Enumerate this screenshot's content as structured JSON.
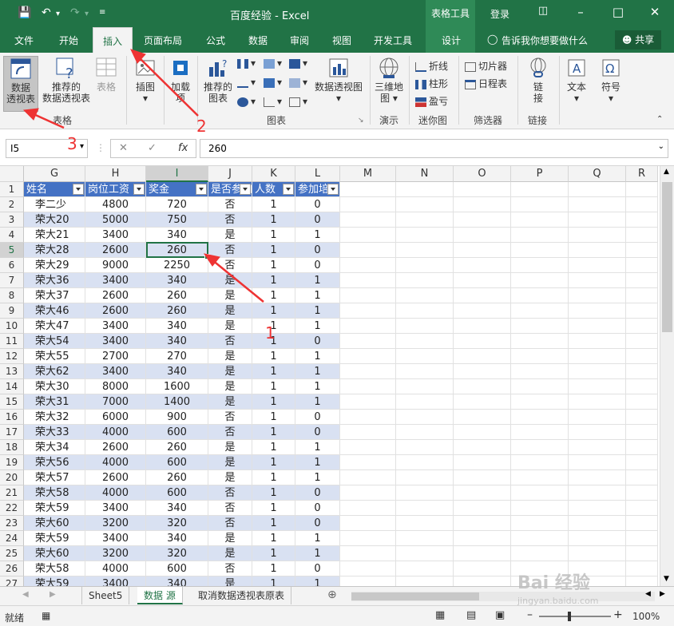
{
  "titlebar": {
    "doc_title": "百度经验  -  Excel",
    "context_tab": "表格工具",
    "login": "登录",
    "save_icon": "save-icon",
    "undo_icon": "undo-icon",
    "redo_icon": "redo-icon",
    "customize_icon": "chevron-down-icon"
  },
  "tabs": {
    "items": [
      "文件",
      "开始",
      "插入",
      "页面布局",
      "公式",
      "数据",
      "审阅",
      "视图",
      "开发工具",
      "设计"
    ],
    "active": "插入",
    "tell_me": "告诉我你想要做什么",
    "share": "共享"
  },
  "ribbon": {
    "pivot_table": "数据\n透视表",
    "pivot_table_l1": "数据",
    "pivot_table_l2": "透视表",
    "recommended_pivot_l1": "推荐的",
    "recommended_pivot_l2": "数据透视表",
    "table": "表格",
    "group_tables": "表格",
    "illustrations": "插图",
    "addins_l1": "加载",
    "addins_l2": "项",
    "recommended_charts_l1": "推荐的",
    "recommended_charts_l2": "图表",
    "pivot_chart": "数据透视图",
    "group_charts": "图表",
    "map3d_l1": "三维地",
    "map3d_l2": "图",
    "group_tours": "演示",
    "spark_line": "折线",
    "spark_column": "柱形",
    "spark_winloss": "盈亏",
    "group_sparklines": "迷你图",
    "slicer": "切片器",
    "timeline": "日程表",
    "group_filters": "筛选器",
    "link_l1": "链",
    "link_l2": "接",
    "group_links": "链接",
    "text": "文本",
    "symbol": "符号"
  },
  "formula_bar": {
    "name_box": "I5",
    "fx": "fx",
    "value": "260"
  },
  "grid": {
    "columns": [
      "G",
      "H",
      "I",
      "J",
      "K",
      "L",
      "M",
      "N",
      "O",
      "P",
      "Q",
      "R"
    ],
    "selected_col": "I",
    "selected_row": "5",
    "header_row": [
      "姓名",
      "岗位工资",
      "奖金",
      "是否参加",
      "人数",
      "参加培训"
    ],
    "rows": [
      {
        "n": "2",
        "c": [
          "李二少",
          "4800",
          "720",
          "否",
          "1",
          "0"
        ]
      },
      {
        "n": "3",
        "c": [
          "荣大20",
          "5000",
          "750",
          "否",
          "1",
          "0"
        ]
      },
      {
        "n": "4",
        "c": [
          "荣大21",
          "3400",
          "340",
          "是",
          "1",
          "1"
        ]
      },
      {
        "n": "5",
        "c": [
          "荣大28",
          "2600",
          "260",
          "否",
          "1",
          "0"
        ]
      },
      {
        "n": "6",
        "c": [
          "荣大29",
          "9000",
          "2250",
          "否",
          "1",
          "0"
        ]
      },
      {
        "n": "7",
        "c": [
          "荣大36",
          "3400",
          "340",
          "是",
          "1",
          "1"
        ]
      },
      {
        "n": "8",
        "c": [
          "荣大37",
          "2600",
          "260",
          "是",
          "1",
          "1"
        ]
      },
      {
        "n": "9",
        "c": [
          "荣大46",
          "2600",
          "260",
          "是",
          "1",
          "1"
        ]
      },
      {
        "n": "10",
        "c": [
          "荣大47",
          "3400",
          "340",
          "是",
          "1",
          "1"
        ]
      },
      {
        "n": "11",
        "c": [
          "荣大54",
          "3400",
          "340",
          "否",
          "1",
          "0"
        ]
      },
      {
        "n": "12",
        "c": [
          "荣大55",
          "2700",
          "270",
          "是",
          "1",
          "1"
        ]
      },
      {
        "n": "13",
        "c": [
          "荣大62",
          "3400",
          "340",
          "是",
          "1",
          "1"
        ]
      },
      {
        "n": "14",
        "c": [
          "荣大30",
          "8000",
          "1600",
          "是",
          "1",
          "1"
        ]
      },
      {
        "n": "15",
        "c": [
          "荣大31",
          "7000",
          "1400",
          "是",
          "1",
          "1"
        ]
      },
      {
        "n": "16",
        "c": [
          "荣大32",
          "6000",
          "900",
          "否",
          "1",
          "0"
        ]
      },
      {
        "n": "17",
        "c": [
          "荣大33",
          "4000",
          "600",
          "否",
          "1",
          "0"
        ]
      },
      {
        "n": "18",
        "c": [
          "荣大34",
          "2600",
          "260",
          "是",
          "1",
          "1"
        ]
      },
      {
        "n": "19",
        "c": [
          "荣大56",
          "4000",
          "600",
          "是",
          "1",
          "1"
        ]
      },
      {
        "n": "20",
        "c": [
          "荣大57",
          "2600",
          "260",
          "是",
          "1",
          "1"
        ]
      },
      {
        "n": "21",
        "c": [
          "荣大58",
          "4000",
          "600",
          "否",
          "1",
          "0"
        ]
      },
      {
        "n": "22",
        "c": [
          "荣大59",
          "3400",
          "340",
          "否",
          "1",
          "0"
        ]
      },
      {
        "n": "23",
        "c": [
          "荣大60",
          "3200",
          "320",
          "否",
          "1",
          "0"
        ]
      },
      {
        "n": "24",
        "c": [
          "荣大59",
          "3400",
          "340",
          "是",
          "1",
          "1"
        ]
      },
      {
        "n": "25",
        "c": [
          "荣大60",
          "3200",
          "320",
          "是",
          "1",
          "1"
        ]
      },
      {
        "n": "26",
        "c": [
          "荣大58",
          "4000",
          "600",
          "否",
          "1",
          "0"
        ]
      },
      {
        "n": "27",
        "c": [
          "荣大59",
          "3400",
          "340",
          "是",
          "1",
          "1"
        ]
      }
    ]
  },
  "sheet_tabs": {
    "items": [
      "Sheet5",
      "数据 源",
      "取消数据透视表原表"
    ],
    "active": "数据 源",
    "add_icon": "plus-icon"
  },
  "status": {
    "ready": "就绪",
    "zoom": "100%"
  },
  "annotations": {
    "n1": "1",
    "n2": "2",
    "n3": "3"
  },
  "watermark": {
    "brand": "Bai 经验",
    "url": "jingyan.baidu.com"
  },
  "colors": {
    "excel_green": "#217346",
    "table_header": "#4472c4",
    "band": "#d9e1f2",
    "annotation": "#e33333"
  }
}
